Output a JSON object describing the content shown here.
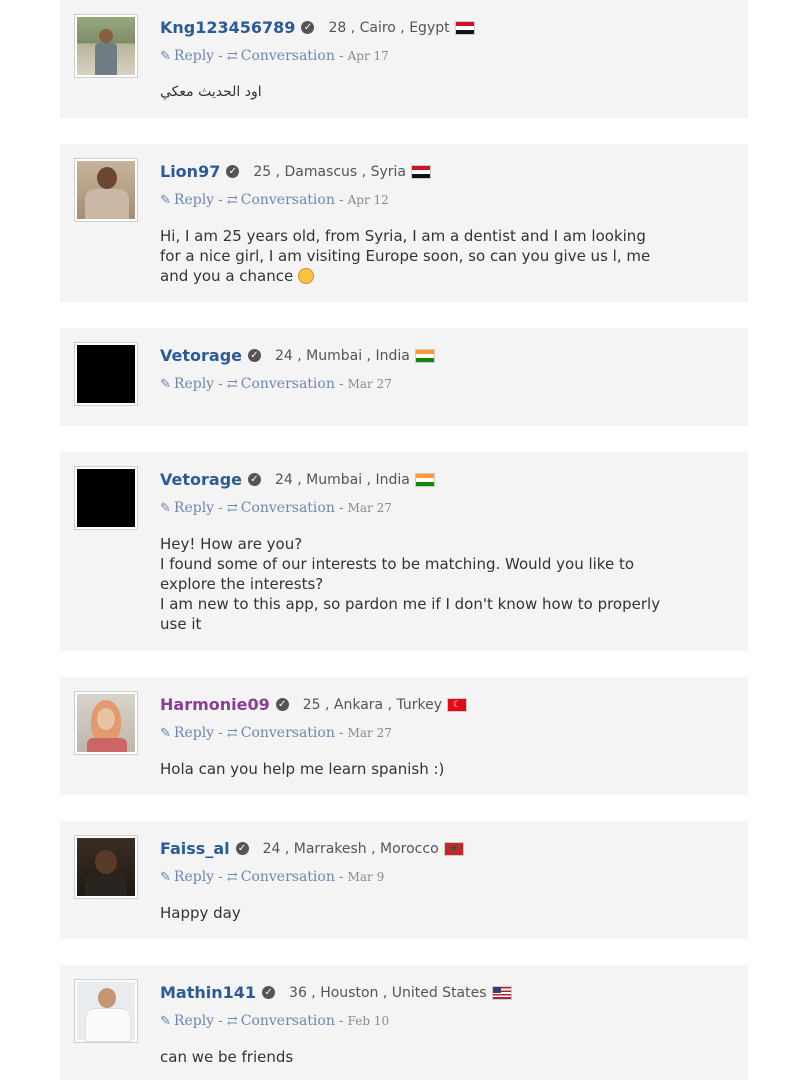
{
  "comments": [
    {
      "username": "Kng123456789",
      "meta": "28 , Cairo , Egypt",
      "flag": "egypt-flag",
      "reply": "Reply",
      "conversation": "Conversation",
      "date": "Apr 17",
      "message": "اود الحديث معكي",
      "message_rtl": true
    },
    {
      "username": "Lion97",
      "meta": "25 , Damascus , Syria",
      "flag": "syria-flag",
      "reply": "Reply",
      "conversation": "Conversation",
      "date": "Apr 12",
      "message": "Hi, I am 25 years old, from Syria, I am a dentist and I am looking for a nice girl, I am visiting Europe soon, so can you give us l, me and you a chance",
      "emoji": "winking-smile-emoji"
    },
    {
      "username": "Vetorage",
      "meta": "24 , Mumbai , India",
      "flag": "india-flag",
      "reply": "Reply",
      "conversation": "Conversation",
      "date": "Mar 27",
      "message": ""
    },
    {
      "username": "Vetorage",
      "meta": "24 , Mumbai , India",
      "flag": "india-flag",
      "reply": "Reply",
      "conversation": "Conversation",
      "date": "Mar 27",
      "message": "Hey! How are you?\nI found some of our interests to be matching. Would you like to explore the interests?\nI am new to this app, so pardon me if I don't know how to properly use it"
    },
    {
      "username": "Harmonie09",
      "meta": "25 , Ankara , Turkey",
      "flag": "turkey-flag",
      "reply": "Reply",
      "conversation": "Conversation",
      "date": "Mar 27",
      "message": "Hola can you help me learn spanish :)"
    },
    {
      "username": "Faiss_al",
      "meta": "24 , Marrakesh , Morocco",
      "flag": "morocco-flag",
      "reply": "Reply",
      "conversation": "Conversation",
      "date": "Mar 9",
      "message": "Happy day"
    },
    {
      "username": "Mathin141",
      "meta": "36 , Houston , United States",
      "flag": "us-flag",
      "reply": "Reply",
      "conversation": "Conversation",
      "date": "Feb 10",
      "message": "can we be friends"
    }
  ],
  "colors": {
    "username": "#2c5a96",
    "username_female": "#8a3d93",
    "link": "#6f87ad",
    "card_bg": "#f4f4f4"
  }
}
